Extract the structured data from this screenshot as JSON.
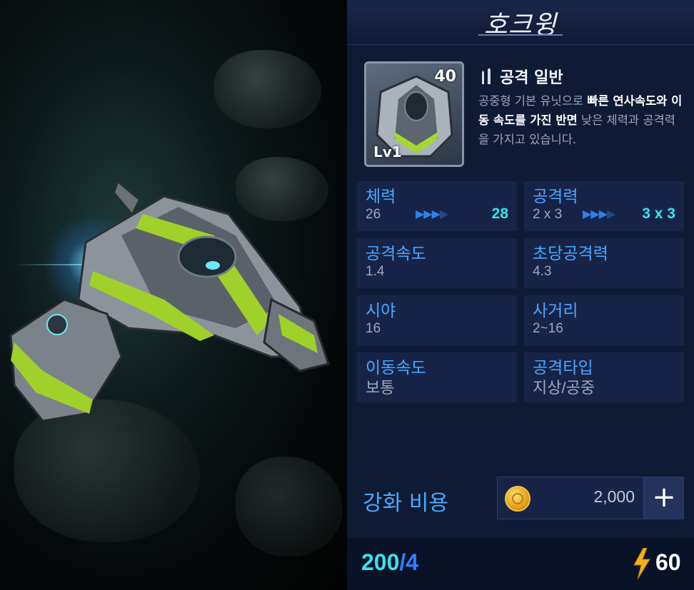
{
  "unit": {
    "name": "호크윙",
    "level_badge": "40",
    "level_text": "Lv1",
    "type_label": "공격 일반",
    "desc_1": "공중형 기본 유닛으로 ",
    "desc_2": "빠른 연사속도와 이동 속도를 가진 반면",
    "desc_3": " 낮은 체력과 공격력을 가지고 있습니다."
  },
  "stats": {
    "hp": {
      "label": "체력",
      "value": "26",
      "next": "28"
    },
    "attack": {
      "label": "공격력",
      "value": "2 x 3",
      "next": "3 x 3"
    },
    "attack_speed": {
      "label": "공격속도",
      "value": "1.4"
    },
    "dps": {
      "label": "초당공격력",
      "value": "4.3"
    },
    "sight": {
      "label": "시야",
      "value": "16"
    },
    "range": {
      "label": "사거리",
      "value": "2~16"
    },
    "move_speed": {
      "label": "이동속도",
      "value": "보통"
    },
    "attack_type": {
      "label": "공격타입",
      "value": "지상/공중"
    }
  },
  "upgrade": {
    "label": "강화 비용",
    "cost": "2,000",
    "plus": "+"
  },
  "footer": {
    "supply_current": "200",
    "supply_sep": "/",
    "supply_food": "4",
    "energy": "60"
  },
  "colors": {
    "label_blue": "#4aa8ff",
    "next_cyan": "#35e6ea",
    "panel_bg": "#0f1a34",
    "tile_bg": "#172448"
  },
  "icons": {
    "type": "bullet-icon",
    "coin": "gold-coin-icon",
    "energy": "lightning-icon",
    "plus": "plus-icon"
  }
}
